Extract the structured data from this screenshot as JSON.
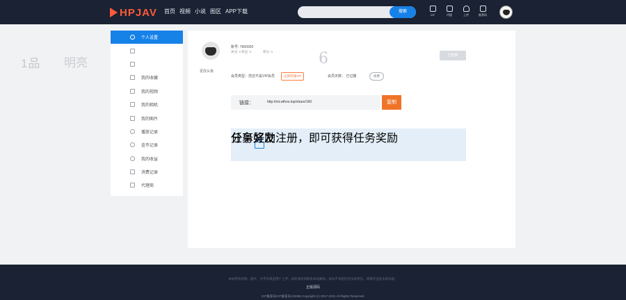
{
  "header": {
    "logo": "HPJAV",
    "nav": [
      "首页",
      "视频",
      "小说",
      "图区",
      "APP下载"
    ],
    "search_placeholder": "",
    "search_button": "搜索",
    "icons": [
      {
        "name": "vip-icon",
        "label": "VIP"
      },
      {
        "name": "agent-icon",
        "label": "代理"
      },
      {
        "name": "upload-icon",
        "label": "上传"
      },
      {
        "name": "promo-icon",
        "label": "推荐码"
      }
    ]
  },
  "background_deco": {
    "left1": "1品",
    "left2": "明亮"
  },
  "sidebar": {
    "items": [
      {
        "label": "个人设置",
        "active": true
      },
      {
        "label": "",
        "active": false
      },
      {
        "label": "",
        "active": false
      },
      {
        "label": "我的收藏",
        "active": false
      },
      {
        "label": "我的视频",
        "active": false
      },
      {
        "label": "我的相机",
        "active": false
      },
      {
        "label": "我的图片",
        "active": false
      },
      {
        "label": "播放记录",
        "active": false
      },
      {
        "label": "金币记录",
        "active": false
      },
      {
        "label": "我的收益",
        "active": false
      },
      {
        "label": "消费记录",
        "active": false
      },
      {
        "label": "代理商",
        "active": false
      }
    ]
  },
  "profile": {
    "edit_avatar": "更改头像",
    "username": "账号: 7860000",
    "stat1": "关注: 0   粉丝: 0",
    "stat2": "积分: 0",
    "level_number": "6",
    "signin_button": "已签到",
    "member_type_label": "会员类型：您还不是VIP会员",
    "open_vip_button": "立即开通VIP",
    "member_days_label": "会员天数：  已过期",
    "renew_button": "续费"
  },
  "share": {
    "label": "链接：",
    "url": "http://mt.wlhnx.top/share/160",
    "copy_button": "复制"
  },
  "task": {
    "title": "任务奖励",
    "desc": "分享好友注册，即可获得任务奖励"
  },
  "footer": {
    "line1": "本站所有视频、图片、文字均来自用户上传，如有侵权请联系本站删除。本站不承担任何法律责任，请遵守当地法律法规。",
    "line2": "正版源码",
    "line3": "ICP备案号ICP备案号123456   Copyright (c) 2017-2021 All Rights Reserved."
  }
}
